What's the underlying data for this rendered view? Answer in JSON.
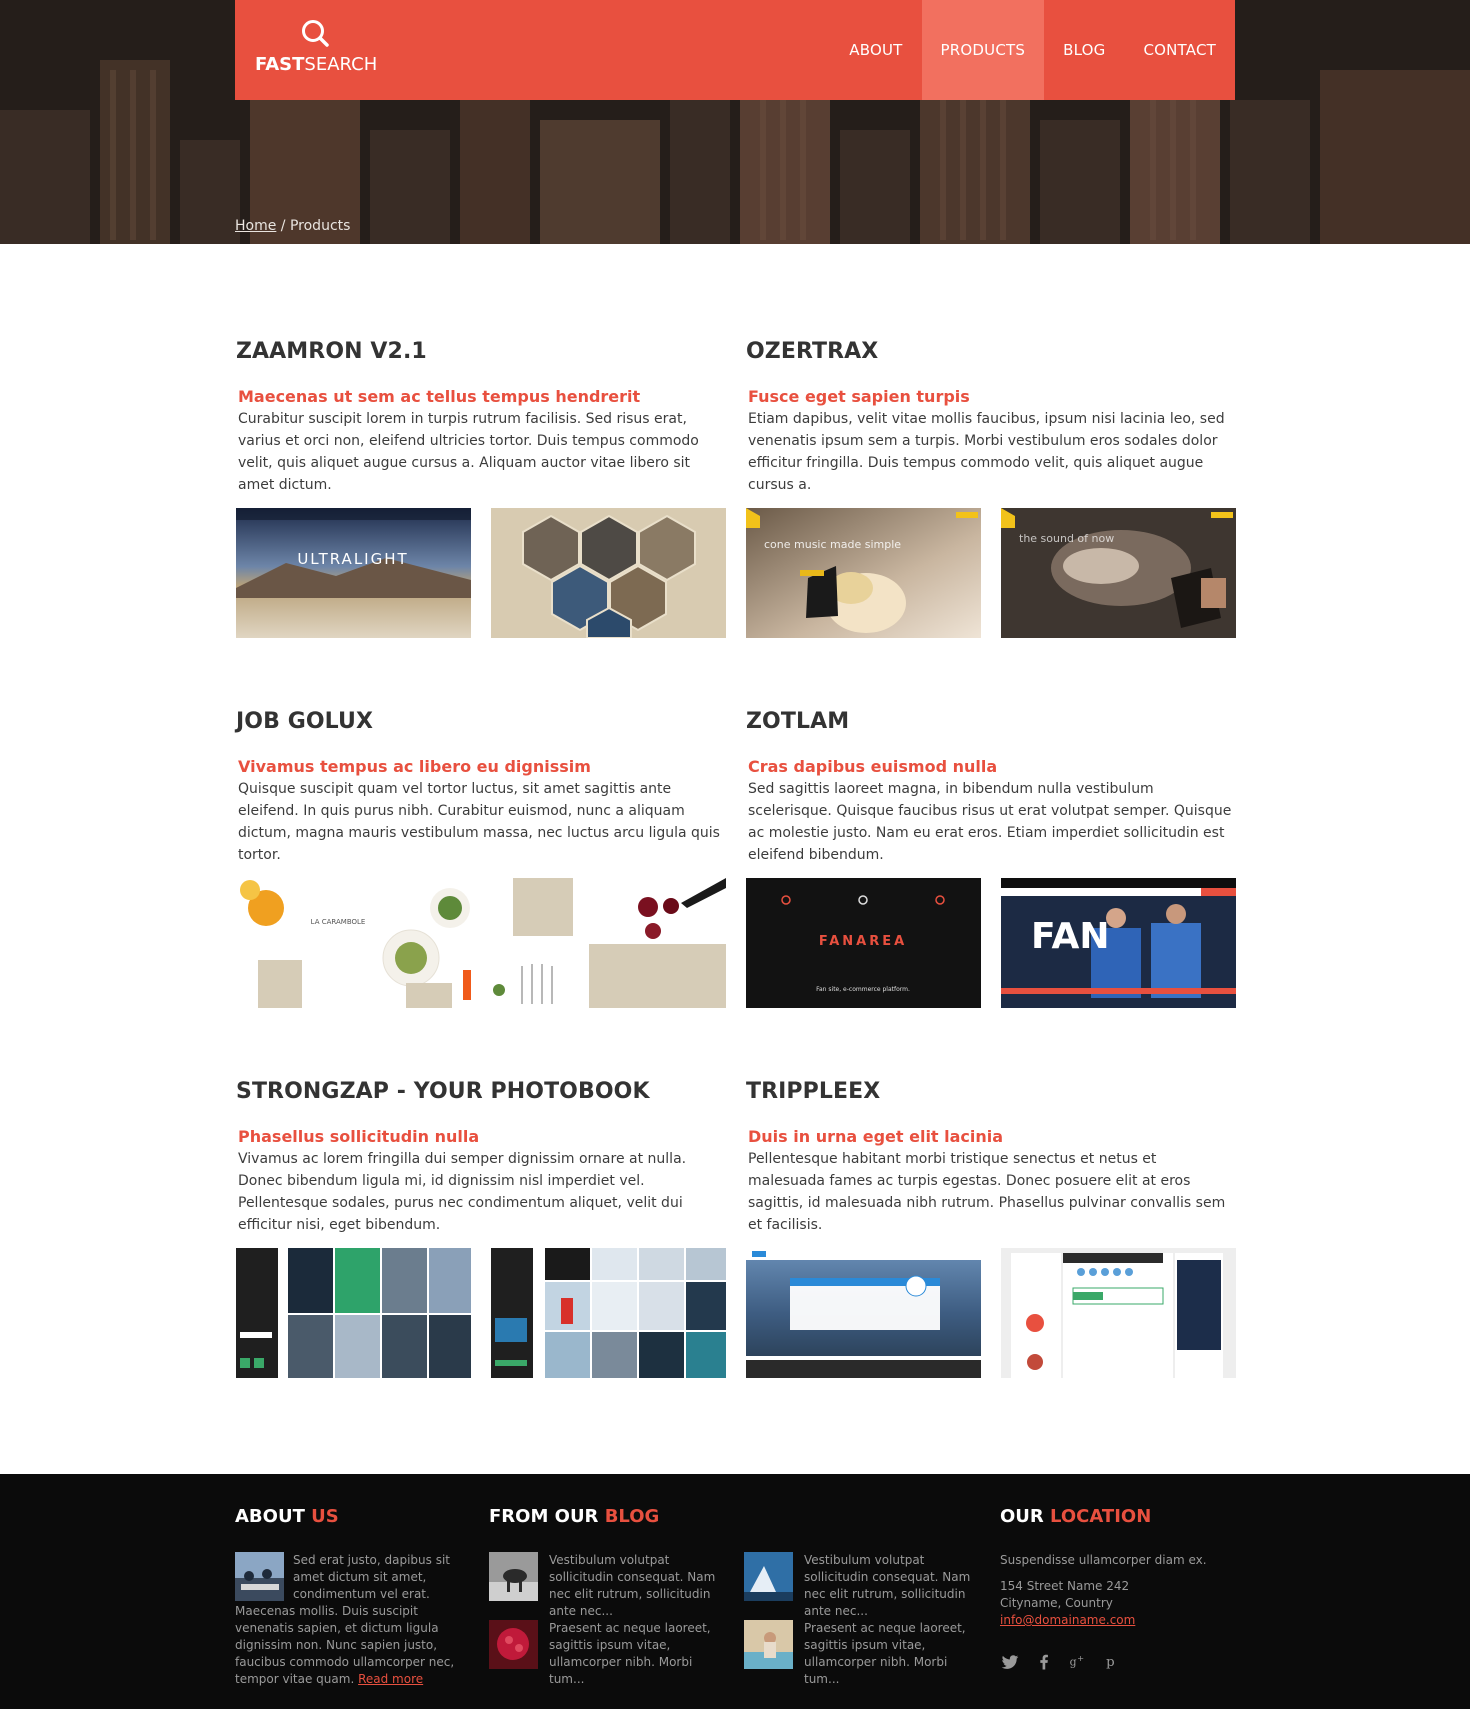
{
  "header": {
    "logo_bold": "FAST",
    "logo_light": "SEARCH",
    "nav": [
      {
        "label": "ABOUT"
      },
      {
        "label": "PRODUCTS"
      },
      {
        "label": "BLOG"
      },
      {
        "label": "CONTACT"
      }
    ],
    "active_nav": "PRODUCTS"
  },
  "breadcrumb": {
    "home": "Home",
    "separator": " / ",
    "current": "Products"
  },
  "products": [
    {
      "title": "ZAAMRON V2.1",
      "subtitle": "Maecenas ut sem ac tellus tempus hendrerit",
      "text": "Curabitur suscipit lorem in turpis rutrum facilisis. Sed risus erat, varius et orci non, eleifend ultricies tortor. Duis tempus commodo velit, quis aliquet augue cursus a. Aliquam auctor vitae libero sit amet dictum.",
      "thumb1_text": "ULTRALIGHT"
    },
    {
      "title": "OZERTRAX",
      "subtitle": "Fusce eget sapien turpis",
      "text": "Etiam dapibus, velit vitae mollis faucibus, ipsum nisi lacinia leo, sed venenatis ipsum sem a turpis. Morbi vestibulum eros sodales dolor efficitur fringilla. Duis tempus commodo velit, quis aliquet augue cursus a.",
      "thumb1_text": "cone music made simple",
      "thumb2_text": "the sound of now"
    },
    {
      "title": "JOB GOLUX",
      "subtitle": "Vivamus tempus ac libero eu dignissim",
      "text": "Quisque suscipit quam vel tortor luctus, sit amet sagittis ante eleifend. In quis purus nibh. Curabitur euismod, nunc a aliquam dictum, magna mauris vestibulum massa, nec luctus arcu ligula quis tortor.",
      "thumb1_text": "LA CARAMBOLE"
    },
    {
      "title": "ZOTLAM",
      "subtitle": "Cras dapibus euismod nulla",
      "text": "Sed sagittis laoreet magna, in bibendum nulla vestibulum scelerisque. Quisque faucibus risus ut erat volutpat semper. Quisque ac molestie justo. Nam eu erat eros. Etiam imperdiet sollicitudin est eleifend bibendum.",
      "thumb1_text": "FANAREA",
      "thumb1_sub": "Fan site, e-commerce platform.",
      "thumb2_text": "FAN"
    },
    {
      "title": "STRONGZAP - YOUR PHOTOBOOK",
      "subtitle": "Phasellus sollicitudin nulla",
      "text": "Vivamus ac lorem fringilla dui semper dignissim ornare at nulla. Donec bibendum ligula mi, id dignissim nisl imperdiet vel. Pellentesque sodales, purus nec condimentum aliquet, velit dui efficitur nisi, eget bibendum."
    },
    {
      "title": "TRIPPLEEX",
      "subtitle": "Duis in urna eget elit lacinia",
      "text": " Pellentesque habitant morbi tristique senectus et netus et malesuada fames ac turpis egestas. Donec posuere elit at eros sagittis, id malesuada nibh rutrum. Phasellus pulvinar convallis sem et facilisis."
    }
  ],
  "footer": {
    "about": {
      "title_a": "ABOUT ",
      "title_b": "US",
      "text": "Sed erat justo, dapibus sit amet dictum sit amet, condimentum vel erat. Maecenas mollis. Duis suscipit venenatis sapien, et dictum ligula dignissim non. Nunc sapien justo, faucibus commodo ullamcorper nec, tempor vitae quam.",
      "link": "Read more"
    },
    "blog": {
      "title_a": "FROM OUR ",
      "title_b": "BLOG",
      "posts": [
        {
          "text": "Vestibulum volutpat sollicitudin consequat. Nam nec elit rutrum, sollicitudin ante nec..."
        },
        {
          "text": "Praesent ac neque laoreet, sagittis ipsum vitae, ullamcorper nibh. Morbi tum..."
        },
        {
          "text": "Vestibulum volutpat sollicitudin consequat. Nam nec elit rutrum, sollicitudin ante nec..."
        },
        {
          "text": "Praesent ac neque laoreet, sagittis ipsum vitae, ullamcorper nibh. Morbi tum..."
        }
      ]
    },
    "location": {
      "title_a": "OUR ",
      "title_b": "LOCATION",
      "line1": "Suspendisse ullamcorper diam ex.",
      "line2": "154 Street Name 242",
      "line3": "Cityname, Country",
      "email": "info@domainame.com"
    },
    "social_icons": [
      "twitter-icon",
      "facebook-icon",
      "google-plus-icon",
      "pinterest-icon"
    ]
  },
  "colors": {
    "accent": "#e8503f",
    "accent_light": "#f2705f",
    "footer_bg": "#0b0b0b"
  }
}
